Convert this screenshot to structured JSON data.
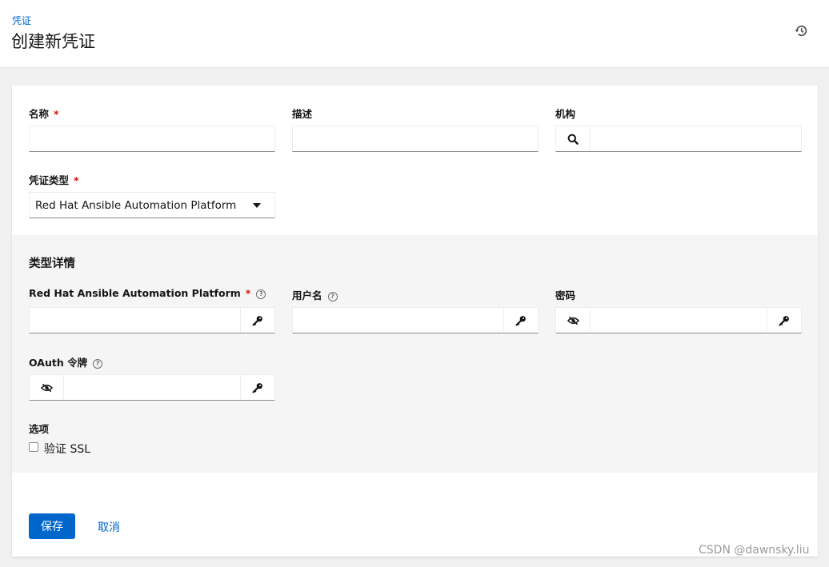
{
  "header": {
    "breadcrumb": "凭证",
    "title": "创建新凭证"
  },
  "form": {
    "name_label": "名称",
    "description_label": "描述",
    "organization_label": "机构",
    "credential_type_label": "凭证类型",
    "credential_type_value": "Red Hat Ansible Automation Platform",
    "required_marker": "*"
  },
  "type_details": {
    "section_title": "类型详情",
    "host_label": "Red Hat Ansible Automation Platform",
    "username_label": "用户名",
    "password_label": "密码",
    "oauth_label": "OAuth 令牌",
    "options_label": "选项",
    "verify_ssl_label": "验证 SSL",
    "verify_ssl_checked": false
  },
  "actions": {
    "save_label": "保存",
    "cancel_label": "取消"
  },
  "watermark": "CSDN @dawnsky.liu",
  "colors": {
    "primary": "#0066cc",
    "required": "#c9190b"
  },
  "icons": [
    "history-icon",
    "search-icon",
    "key-icon",
    "eye-slash-icon",
    "help-icon"
  ]
}
